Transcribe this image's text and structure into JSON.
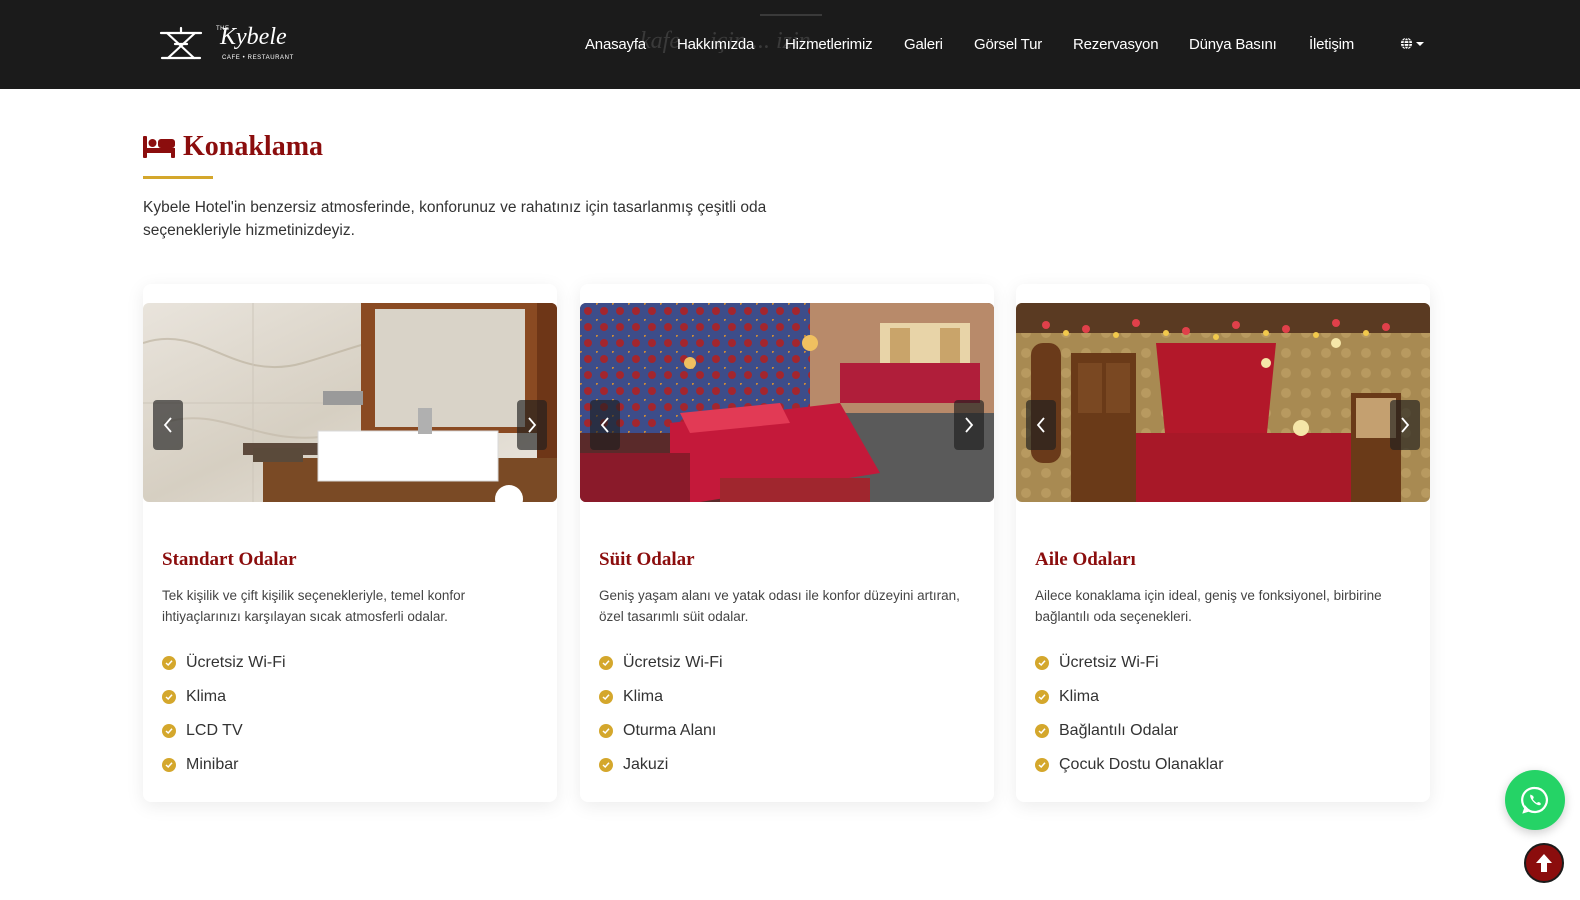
{
  "brand": {
    "the": "THE",
    "name": "Kybele",
    "subtitle": "CAFE • RESTAURANT"
  },
  "header_ghost_text": "kafe ... için ... izin ...",
  "nav": {
    "items": [
      "Anasayfa",
      "Hakkımızda",
      "Hizmetlerimiz",
      "Galeri",
      "Görsel Tur",
      "Rezervasyon",
      "Dünya Basını",
      "İletişim"
    ],
    "language_icon": "globe-icon"
  },
  "section": {
    "icon": "bed-icon",
    "title": "Konaklama",
    "description": "Kybele Hotel'in benzersiz atmosferinde, konforunuz ve rahatınız için tasarlanmış çeşitli oda seçenekleriyle hizmetinizdeyiz."
  },
  "cards": [
    {
      "title": "Standart Odalar",
      "description": "Tek kişilik ve çift kişilik seçenekleriyle, temel konfor ihtiyaçlarınızı karşılayan sıcak atmosferli odalar.",
      "features": [
        "Ücretsiz Wi-Fi",
        "Klima",
        "LCD TV",
        "Minibar"
      ]
    },
    {
      "title": "Süit Odalar",
      "description": "Geniş yaşam alanı ve yatak odası ile konfor düzeyini artıran, özel tasarımlı süit odalar.",
      "features": [
        "Ücretsiz Wi-Fi",
        "Klima",
        "Oturma Alanı",
        "Jakuzi"
      ]
    },
    {
      "title": "Aile Odaları",
      "description": "Ailece konaklama için ideal, geniş ve fonksiyonel, birbirine bağlantılı oda seçenekleri.",
      "features": [
        "Ücretsiz Wi-Fi",
        "Klima",
        "Bağlantılı Odalar",
        "Çocuk Dostu Olanaklar"
      ]
    }
  ],
  "colors": {
    "header_bg": "#1b1b1b",
    "accent_red": "#8b0d0d",
    "accent_gold": "#d4a72c",
    "whatsapp_green": "#25d366"
  },
  "floating": {
    "whatsapp_icon": "whatsapp-icon",
    "scroll_top_icon": "arrow-up-icon"
  }
}
